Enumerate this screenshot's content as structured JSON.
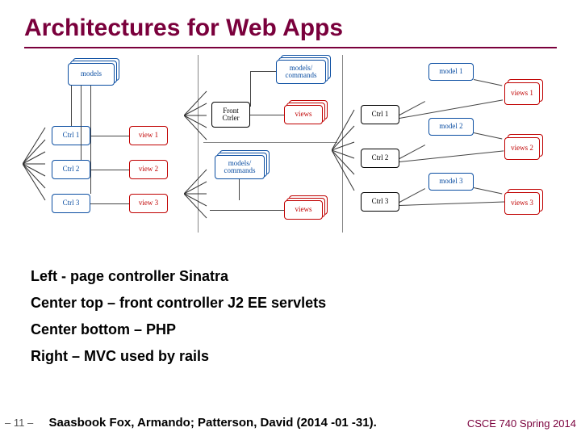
{
  "title": "Architectures for Web Apps",
  "left_panel": {
    "models": "models",
    "ctrl1": "Ctrl 1",
    "ctrl2": "Ctrl 2",
    "ctrl3": "Ctrl 3",
    "view1": "view 1",
    "view2": "view 2",
    "view3": "view 3"
  },
  "center_panel": {
    "front": "Front Ctrler",
    "mc_top": "models/ commands",
    "views_top": "views",
    "mc_bot": "models/ commands",
    "views_bot": "views"
  },
  "right_panel": {
    "ctrl1": "Ctrl 1",
    "ctrl2": "Ctrl 2",
    "ctrl3": "Ctrl 3",
    "model1": "model 1",
    "model2": "model 2",
    "model3": "model 3",
    "views1": "views 1",
    "views2": "views 2",
    "views3": "views 3"
  },
  "bullets": {
    "b1": "Left -  page controller Sinatra",
    "b2": "Center top – front controller J2 EE servlets",
    "b3": "Center bottom – PHP",
    "b4": "Right – MVC used by rails"
  },
  "footer": {
    "page": "– 11 –",
    "cite": "Saasbook Fox, Armando; Patterson, David (2014 -01 -31).",
    "course": "CSCE 740 Spring 2014"
  }
}
